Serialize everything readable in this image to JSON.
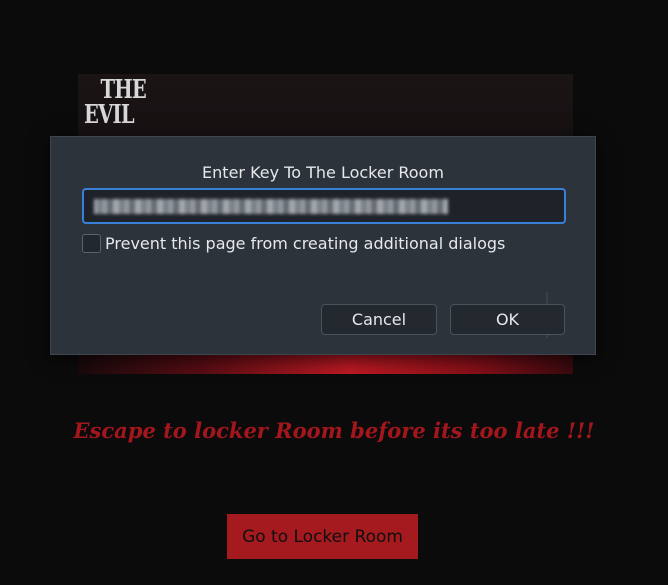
{
  "poster": {
    "logo_line1": "THE",
    "logo_line2": "EVIL"
  },
  "dialog": {
    "title": "Enter Key To The Locker Room",
    "input_value_masked": true,
    "checkbox_label": "Prevent this page from creating additional dialogs",
    "checkbox_checked": false,
    "cancel_label": "Cancel",
    "ok_label": "OK"
  },
  "page": {
    "tagline": "Escape to locker Room before its too late !!!",
    "button_label": "Go to Locker Room"
  },
  "colors": {
    "accent": "#a51a1f",
    "dialog_bg": "#2c333b",
    "input_focus": "#3a7fd8"
  }
}
